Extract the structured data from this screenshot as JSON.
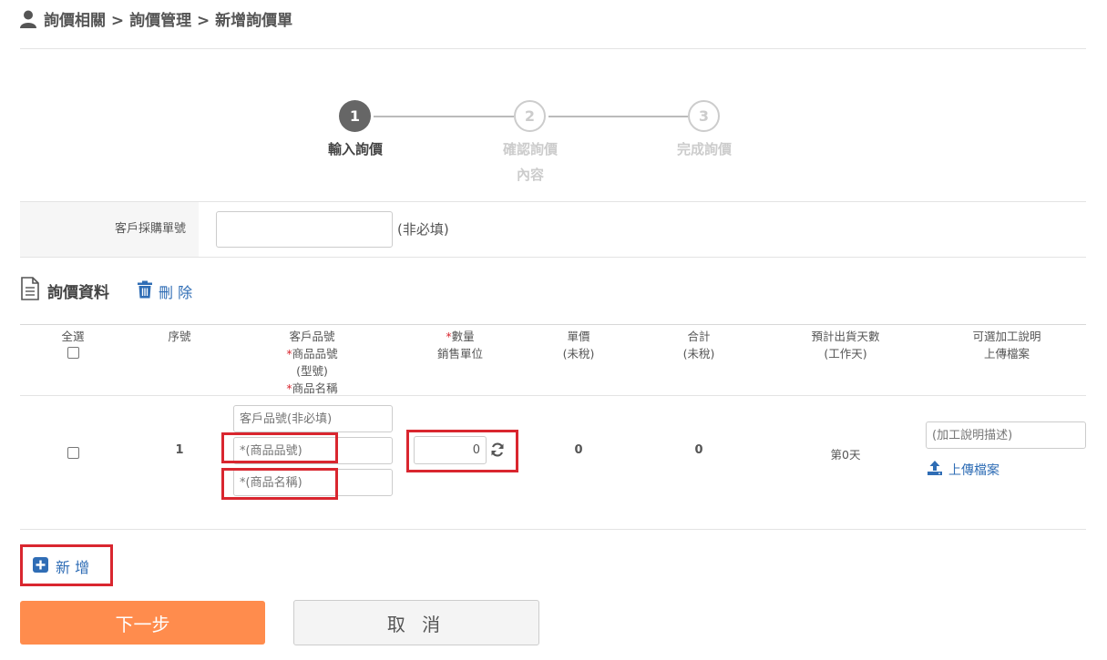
{
  "breadcrumb": {
    "icon": "user-icon",
    "text": "詢價相關 > 詢價管理 > 新增詢價單"
  },
  "steps": [
    {
      "number": "1",
      "label": "輸入詢價",
      "state": "active"
    },
    {
      "number": "2",
      "label": "確認詢價內容",
      "label_line1": "確認詢價",
      "label_line2": "內容",
      "state": "inactive"
    },
    {
      "number": "3",
      "label": "完成詢價",
      "state": "inactive"
    }
  ],
  "customer_po": {
    "label": "客戶採購單號",
    "value": "",
    "hint": "(非必填)"
  },
  "section": {
    "title": "詢價資料",
    "icon": "document-icon",
    "delete_label": "刪 除",
    "delete_icon": "trash-icon"
  },
  "table": {
    "headers": {
      "select_all": "全選",
      "seq": "序號",
      "customer_part": "客戶品號",
      "product_no": "商品品號",
      "model": "(型號)",
      "product_name": "商品名稱",
      "qty": "數量",
      "sales_unit": "銷售單位",
      "unit_price": "單價",
      "unit_price_note": "(未稅)",
      "total": "合計",
      "total_note": "(未稅)",
      "ship_days": "預計出貨天數",
      "ship_days_note": "(工作天)",
      "processing": "可選加工說明",
      "upload_header": "上傳檔案",
      "required_mark": "*"
    },
    "rows": [
      {
        "seq": "1",
        "customer_part_placeholder": "客戶品號(非必填)",
        "product_no_placeholder": "*(商品品號)",
        "product_name_placeholder": "*(商品名稱)",
        "qty": "0",
        "unit_price": "0",
        "total": "0",
        "ship_days": "第0天",
        "processing_placeholder": "(加工說明描述)",
        "upload_label": "上傳檔案"
      }
    ]
  },
  "add_label": "新 增",
  "buttons": {
    "next": "下一步",
    "cancel": "取 消"
  },
  "colors": {
    "accent_orange": "#ff8c4d",
    "link_blue": "#2f6db5",
    "highlight_red": "#d9262f"
  }
}
